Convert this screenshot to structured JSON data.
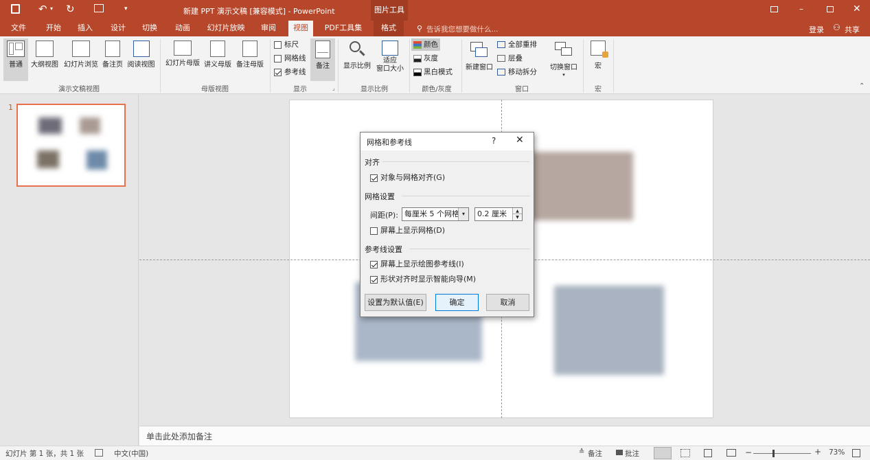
{
  "titlebar": {
    "title": "新建 PPT 演示文稿 [兼容模式] - PowerPoint",
    "context_tab": "图片工具"
  },
  "tabs": [
    "文件",
    "开始",
    "插入",
    "设计",
    "切换",
    "动画",
    "幻灯片放映",
    "审阅",
    "视图",
    "PDF工具集",
    "格式"
  ],
  "tell_me": "告诉我您想要做什么...",
  "account": {
    "signin": "登录",
    "share": "共享"
  },
  "ribbon": {
    "presentation_views": {
      "label": "演示文稿视图",
      "buttons": [
        "普通",
        "大纲视图",
        "幻灯片浏览",
        "备注页",
        "阅读视图"
      ]
    },
    "master_views": {
      "label": "母版视图",
      "buttons": [
        "幻灯片母版",
        "讲义母版",
        "备注母版"
      ]
    },
    "show": {
      "label": "显示",
      "ruler": "标尺",
      "gridlines": "网格线",
      "guides": "参考线",
      "notes": "备注"
    },
    "zoom": {
      "label": "显示比例",
      "zoom_btn": "显示比例",
      "fit_line1": "适应",
      "fit_line2": "窗口大小"
    },
    "color": {
      "label": "颜色/灰度",
      "color": "颜色",
      "gray": "灰度",
      "bw": "黑白模式"
    },
    "window": {
      "label": "窗口",
      "new_window": "新建窗口",
      "arrange_all": "全部重排",
      "cascade": "层叠",
      "move_split": "移动拆分",
      "switch": "切换窗口"
    },
    "macros": {
      "label": "宏",
      "button": "宏"
    }
  },
  "thumbnail_number": "1",
  "notes_placeholder": "单击此处添加备注",
  "dialog": {
    "title": "网格和参考线",
    "help": "?",
    "snap_section": "对齐",
    "snap_to_grid": "对象与网格对齐(G)",
    "grid_section": "网格设置",
    "spacing_label": "间距(P):",
    "spacing_combo": "每厘米 5 个网格",
    "spacing_value": "0.2 厘米",
    "show_grid": "屏幕上显示网格(D)",
    "guide_section": "参考线设置",
    "show_guides": "屏幕上显示绘图参考线(I)",
    "smart_guides": "形状对齐时显示智能向导(M)",
    "default_btn": "设置为默认值(E)",
    "ok_btn": "确定",
    "cancel_btn": "取消",
    "checked": {
      "snap": true,
      "show_grid": false,
      "show_guides": true,
      "smart_guides": true
    }
  },
  "status": {
    "slide_info": "幻灯片 第 1 张，共 1 张",
    "language": "中文(中国)",
    "notes": "备注",
    "comments": "批注",
    "zoom": "73%"
  },
  "colors": {
    "accent": "#b7472a",
    "selection": "#e8704d"
  }
}
